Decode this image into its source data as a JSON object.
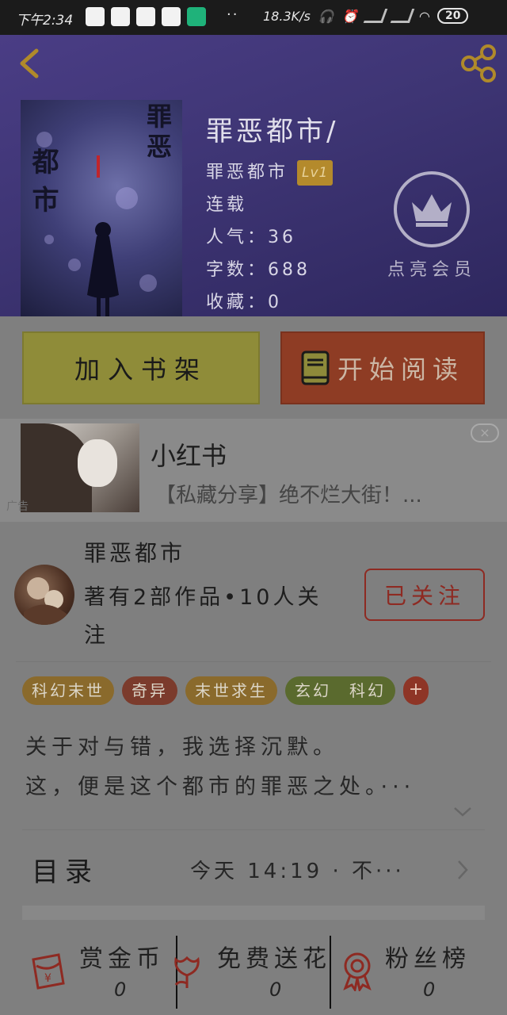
{
  "status_bar": {
    "time": "下午2:34",
    "dots": "··",
    "speed": "18.3K/s",
    "battery": "20"
  },
  "book": {
    "title": "罪恶都市/",
    "author": "罪恶都市",
    "author_level": "Lv1",
    "status": "连载",
    "popularity": "人气：36",
    "word_count": "字数：688",
    "favorites": "收藏：0",
    "cover_text_right": "罪恶",
    "cover_text_left": "都市"
  },
  "member": {
    "label": "点亮会员"
  },
  "actions": {
    "add_to_shelf": "加入书架",
    "start_reading": "开始阅读"
  },
  "ad": {
    "title": "小红书",
    "description": "【私藏分享】绝不烂大街！...",
    "tag": "广告",
    "close": "×"
  },
  "author_card": {
    "name": "罪恶都市",
    "meta": "著有2部作品•10人关注",
    "follow_label": "已关注"
  },
  "tags": [
    {
      "label": "科幻末世",
      "color": "#8a6a2c"
    },
    {
      "label": "奇异",
      "color": "#7b3b2c"
    },
    {
      "label": "末世求生",
      "color": "#8a6a2c"
    },
    {
      "label": "玄幻　科幻",
      "color": "#5a6a2e"
    }
  ],
  "tag_more": "+",
  "description": {
    "line1": "关于对与错，我选择沉默。",
    "line2": "这，便是这个都市的罪恶之处。···"
  },
  "toc": {
    "label": "目录",
    "latest": "今天 14:19 · 不···"
  },
  "bottom_bar": {
    "reward": {
      "label": "赏金币",
      "count": "0"
    },
    "flowers": {
      "label": "免费送花",
      "count": "0"
    },
    "fans": {
      "label": "粉丝榜",
      "count": "0"
    }
  },
  "colors": {
    "header_bg": "#3e3574",
    "shelf_button": "#8f8c39",
    "read_button": "#8e3c24",
    "follow_accent": "#8e2a22",
    "icon_red": "#8e2a22"
  }
}
